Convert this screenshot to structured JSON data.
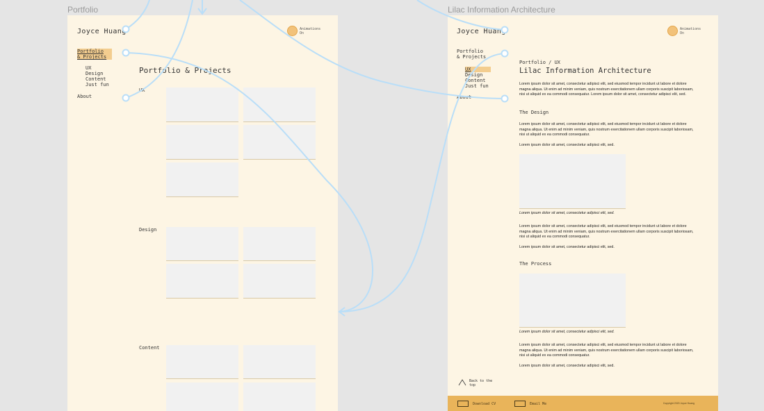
{
  "frames": {
    "portfolio": {
      "label": "Portfolio",
      "logo": "Joyce Huang",
      "animations_badge": "Animations On",
      "nav": {
        "portfolio_line1": "Portfolio",
        "portfolio_line2": "& Projects",
        "sub": [
          "UX",
          "Design",
          "Content",
          "Just fun"
        ],
        "about": "About"
      },
      "page_title": "Portfolio & Projects",
      "sections": [
        "UX",
        "Design",
        "Content"
      ]
    },
    "lilac": {
      "label": "Lilac Information Architecture",
      "logo": "Joyce Huang",
      "animations_badge": "Animations On",
      "nav": {
        "portfolio_line1": "Portfolio",
        "portfolio_line2": "& Projects",
        "sub": [
          "UX",
          "Design",
          "Content",
          "Just fun"
        ],
        "about": "About"
      },
      "breadcrumb": "Portfolio / UX",
      "title": "Lilac Information Architecture",
      "para_long": "Lorem ipsum dolor sit amet, consectetur adipisci elit, sed eiusmod tempor incidunt ut labore et dolore magna aliqua. Ut enim ad minim veniam, quis nostrum exercitationem ullam corporis suscipit laboriosam, nisi ut aliquid ex ea commodi consequatur. Lorem ipsum dolor sit amet, consectetur adipisci elit, sed.",
      "para_medium": "Lorem ipsum dolor sit amet, consectetur adipisci elit, sed eiusmod tempor incidunt ut labore et dolore magna aliqua. Ut enim ad minim veniam, quis nostrum exercitationem ullam corporis suscipit laboriosam, nisi ut aliquid ex ea commodi consequatur.",
      "para_short": "Lorem ipsum dolor sit amet, consectetur adipisci elit, sed.",
      "caption": "Lorem ipsum dolor sit amet, consectetur adipisci elit, sed.",
      "heading_design": "The Design",
      "heading_process": "The Process",
      "back_to_top": "Back to the top",
      "footer": {
        "download": "Download CV",
        "email": "Email Me",
        "copyright": "Copyright 2020 Joyce Huang"
      }
    }
  },
  "colors": {
    "canvas": "#e5e5e5",
    "frame_bg": "#fdf5e4",
    "accent": "#f3cd8f",
    "footer": "#e9b45a",
    "prototype_wire": "#b9def8"
  }
}
